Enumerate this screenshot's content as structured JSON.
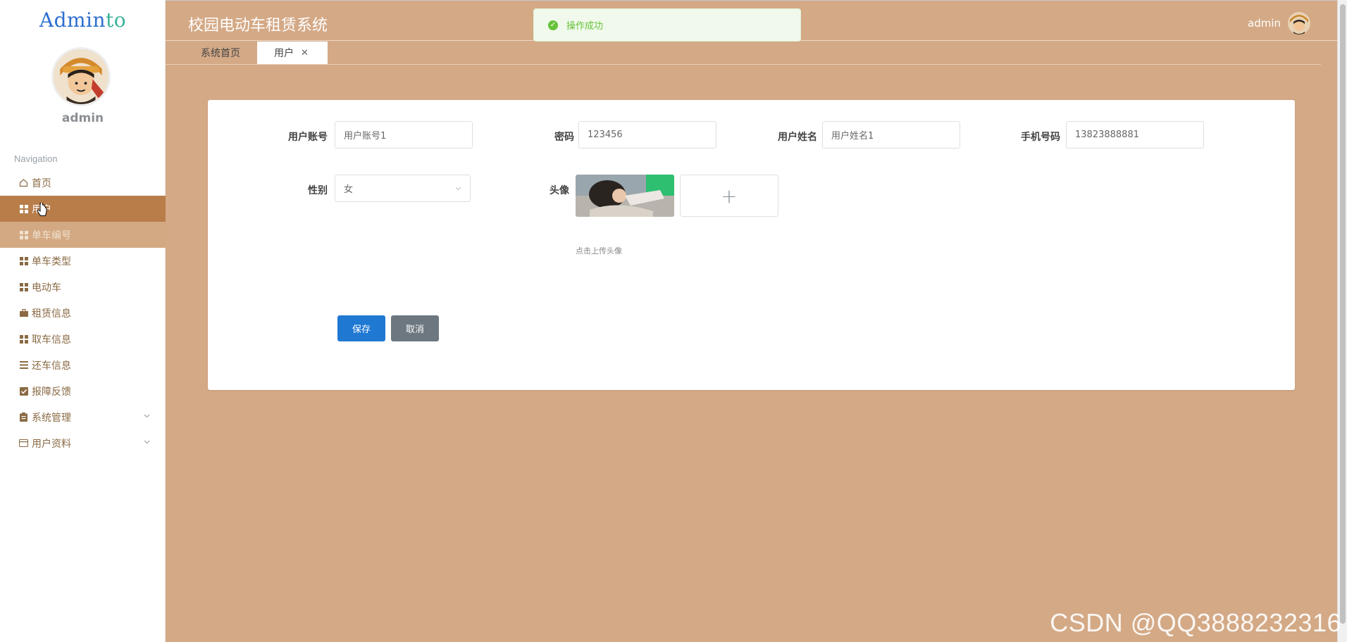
{
  "brand": {
    "logo_text": "Admin",
    "logo_accent": "to"
  },
  "user": {
    "name": "admin"
  },
  "nav": {
    "heading": "Navigation",
    "items": [
      {
        "label": "首页",
        "icon": "home-icon"
      },
      {
        "label": "用户",
        "icon": "grid-icon"
      },
      {
        "label": "单车编号",
        "icon": "grid-icon"
      },
      {
        "label": "单车类型",
        "icon": "grid-icon"
      },
      {
        "label": "电动车",
        "icon": "grid-icon"
      },
      {
        "label": "租赁信息",
        "icon": "briefcase-icon"
      },
      {
        "label": "取车信息",
        "icon": "grid-icon"
      },
      {
        "label": "还车信息",
        "icon": "list-icon"
      },
      {
        "label": "报障反馈",
        "icon": "check-square-icon"
      },
      {
        "label": "系统管理",
        "icon": "clipboard-icon"
      },
      {
        "label": "用户资料",
        "icon": "card-icon"
      }
    ]
  },
  "header": {
    "title": "校园电动车租赁系统",
    "user_label": "admin"
  },
  "toast": {
    "message": "操作成功"
  },
  "tabs": [
    {
      "label": "系统首页"
    },
    {
      "label": "用户"
    }
  ],
  "form": {
    "account": {
      "label": "用户账号",
      "value": "用户账号1"
    },
    "password": {
      "label": "密码",
      "value": "123456"
    },
    "realname": {
      "label": "用户姓名",
      "value": "用户姓名1"
    },
    "phone": {
      "label": "手机号码",
      "value": "13823888881"
    },
    "gender": {
      "label": "性别",
      "value": "女"
    },
    "avatar": {
      "label": "头像",
      "hint": "点击上传头像",
      "upload_symbol": "+"
    },
    "save_label": "保存",
    "cancel_label": "取消"
  },
  "watermark": "CSDN @QQ3888232316",
  "colors": {
    "background": "#d4a986",
    "active_nav": "#b97d49",
    "primary": "#1f78d1",
    "success": "#67c23a"
  }
}
